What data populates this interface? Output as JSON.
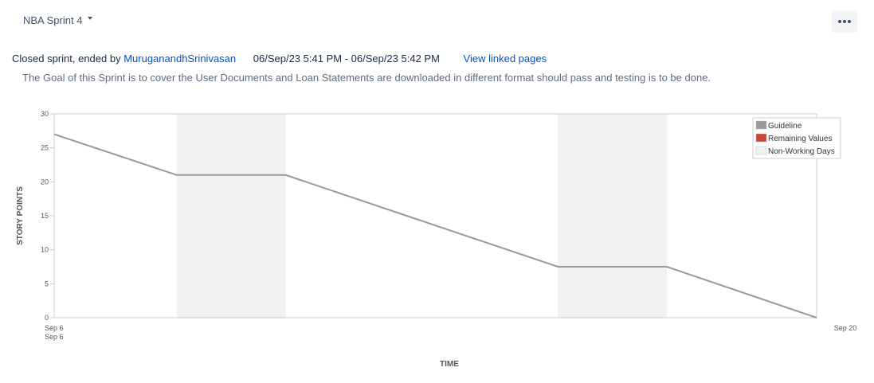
{
  "header": {
    "sprint_name": "NBA Sprint 4",
    "more_label": "More actions"
  },
  "sprint_info": {
    "status_prefix": "Closed sprint, ended by ",
    "ended_by": "MuruganandhSrinivasan",
    "date_range": "06/Sep/23 5:41 PM - 06/Sep/23 5:42 PM",
    "view_linked_pages": "View linked pages",
    "goal": "The Goal of this Sprint is to cover the User Documents and Loan Statements are downloaded in different format should pass and testing is to be done."
  },
  "colors": {
    "guideline": "#999999",
    "remaining": "#d04437",
    "non_working": "#f2f2f2",
    "axis": "#cccccc",
    "link": "#0052cc"
  },
  "chart_data": {
    "type": "line",
    "xlabel": "TIME",
    "ylabel": "STORY POINTS",
    "ylim": [
      0,
      30
    ],
    "yticks": [
      0,
      5,
      10,
      15,
      20,
      25,
      30
    ],
    "xlim_days": [
      0,
      14
    ],
    "x_tick_labels": [
      {
        "day": 0,
        "label": "Sep 6"
      },
      {
        "day": 0,
        "label": "Sep 6"
      },
      {
        "day": 14,
        "label": "Sep 20"
      }
    ],
    "legend": {
      "position": "top-right",
      "entries": [
        "Guideline",
        "Remaining Values",
        "Non-Working Days"
      ]
    },
    "non_working_days": [
      [
        2.25,
        4.25
      ],
      [
        9.25,
        11.25
      ]
    ],
    "series": [
      {
        "name": "Guideline",
        "points": [
          [
            0,
            27
          ],
          [
            2.25,
            21
          ],
          [
            4.25,
            21
          ],
          [
            9.25,
            7.5
          ],
          [
            11.25,
            7.5
          ],
          [
            14,
            0
          ]
        ]
      }
    ]
  }
}
